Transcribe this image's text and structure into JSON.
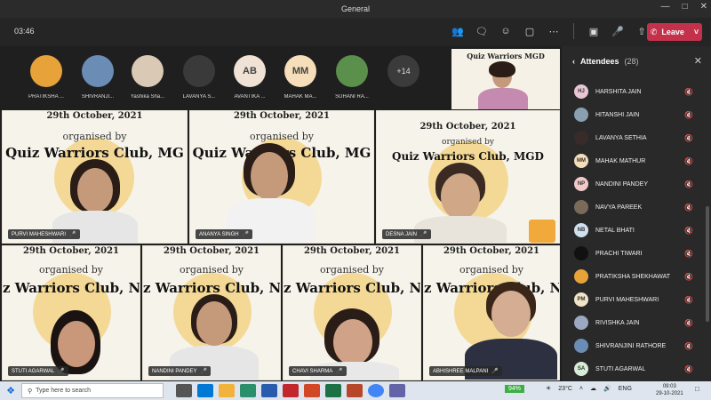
{
  "window": {
    "title": "General"
  },
  "toolbar": {
    "timer": "03:46",
    "leave_label": "Leave"
  },
  "strip": {
    "participants": [
      {
        "name": "PRATIKSHA ...",
        "initials": "",
        "color": "#e8a23a"
      },
      {
        "name": "SHIVRANJI...",
        "initials": "",
        "color": "#6b8db5"
      },
      {
        "name": "Yashika Sha...",
        "initials": "",
        "color": "#d9c9b5"
      },
      {
        "name": "LAVANYA S...",
        "initials": "",
        "color": "#3a3a3a"
      },
      {
        "name": "AVANTIKA ...",
        "initials": "AB",
        "color": "#f0e3d6"
      },
      {
        "name": "MAHAK MA...",
        "initials": "MM",
        "color": "#f5deb9"
      },
      {
        "name": "SUHANI RA...",
        "initials": "",
        "color": "#5a8f4c"
      }
    ],
    "more_label": "+14"
  },
  "presenter": {
    "banner": "Quiz Warriors MGD"
  },
  "tiles": {
    "date": "29th October, 2021",
    "org": "organised by",
    "club_full": "Quiz Warriors Club, MGD",
    "club_cut": "Quiz Warriors Club, MG",
    "club_cut2": "z Warriors Club, N",
    "people": [
      {
        "name": "PURVI MAHESHWARI"
      },
      {
        "name": "ANANYA SINGH"
      },
      {
        "name": "DESNA JAIN"
      },
      {
        "name": "STUTI AGARWAL"
      },
      {
        "name": "NANDINI PANDEY"
      },
      {
        "name": "CHAVI SHARMA"
      },
      {
        "name": "ABHISHREE MALPANI"
      }
    ]
  },
  "attendees": {
    "title": "Attendees",
    "count": "(28)",
    "list": [
      {
        "name": "HARSHITA JAIN",
        "initials": "HJ",
        "color": "#e8c6d4"
      },
      {
        "name": "HITANSHI JAIN",
        "initials": "",
        "color": "#8aa0b0"
      },
      {
        "name": "LAVANYA SETHIA",
        "initials": "",
        "color": "#3a2b2b"
      },
      {
        "name": "MAHAK MATHUR",
        "initials": "MM",
        "color": "#f5deb9"
      },
      {
        "name": "NANDINI PANDEY",
        "initials": "NP",
        "color": "#f2c9c9"
      },
      {
        "name": "NAVYA PAREEK",
        "initials": "",
        "color": "#7a6a5a"
      },
      {
        "name": "NETAL BHATI",
        "initials": "NB",
        "color": "#cfe0f0"
      },
      {
        "name": "PRACHI TIWARI",
        "initials": "",
        "color": "#111111"
      },
      {
        "name": "PRATIKSHA SHEKHAWAT",
        "initials": "",
        "color": "#e8a23a"
      },
      {
        "name": "PURVI MAHESHWARI",
        "initials": "PM",
        "color": "#f0e3c6"
      },
      {
        "name": "RIVISHKA JAIN",
        "initials": "",
        "color": "#9aa8c2"
      },
      {
        "name": "SHIVRANJINI RATHORE",
        "initials": "",
        "color": "#6b8db5"
      },
      {
        "name": "STUTI AGARWAL",
        "initials": "SA",
        "color": "#d6ecd6"
      }
    ]
  },
  "taskbar": {
    "search_placeholder": "Type here to search",
    "battery": "94%",
    "weather": "23°C",
    "lang": "ENG",
    "time": "09:03",
    "date": "29-10-2021"
  },
  "colors": {
    "leave": "#c4314b",
    "accent": "#6264a7"
  }
}
